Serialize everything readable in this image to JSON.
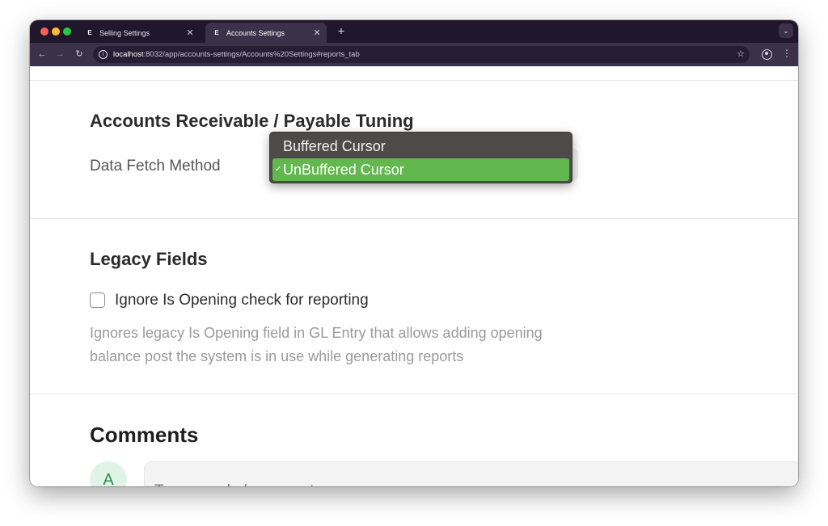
{
  "browser": {
    "tabs": [
      {
        "title": "Selling Settings",
        "favicon": "E",
        "active": false
      },
      {
        "title": "Accounts Settings",
        "favicon": "E",
        "active": true
      }
    ],
    "new_tab_label": "+",
    "url_host": "localhost",
    "url_rest": ":8032/app/accounts-settings/Accounts%20Settings#reports_tab"
  },
  "sections": {
    "ar_ap": {
      "title": "Accounts Receivable / Payable Tuning",
      "field_label": "Data Fetch Method",
      "options": [
        "Buffered Cursor",
        "UnBuffered Cursor"
      ],
      "selected": "UnBuffered Cursor"
    },
    "legacy": {
      "title": "Legacy Fields",
      "checkbox_label": "Ignore Is Opening check for reporting",
      "checked": false,
      "description": "Ignores legacy Is Opening field in GL Entry that allows adding opening balance post the system is in use while generating reports"
    },
    "comments": {
      "title": "Comments",
      "avatar_initial": "A",
      "placeholder": "Type a reply / comment"
    }
  },
  "colors": {
    "titlebar": "#20172c",
    "toolbar": "#3b3149",
    "dropdown_bg": "#4d4b49",
    "selected_option": "#62b84e",
    "avatar_bg": "#dff4e6",
    "avatar_text": "#2f8a52"
  }
}
